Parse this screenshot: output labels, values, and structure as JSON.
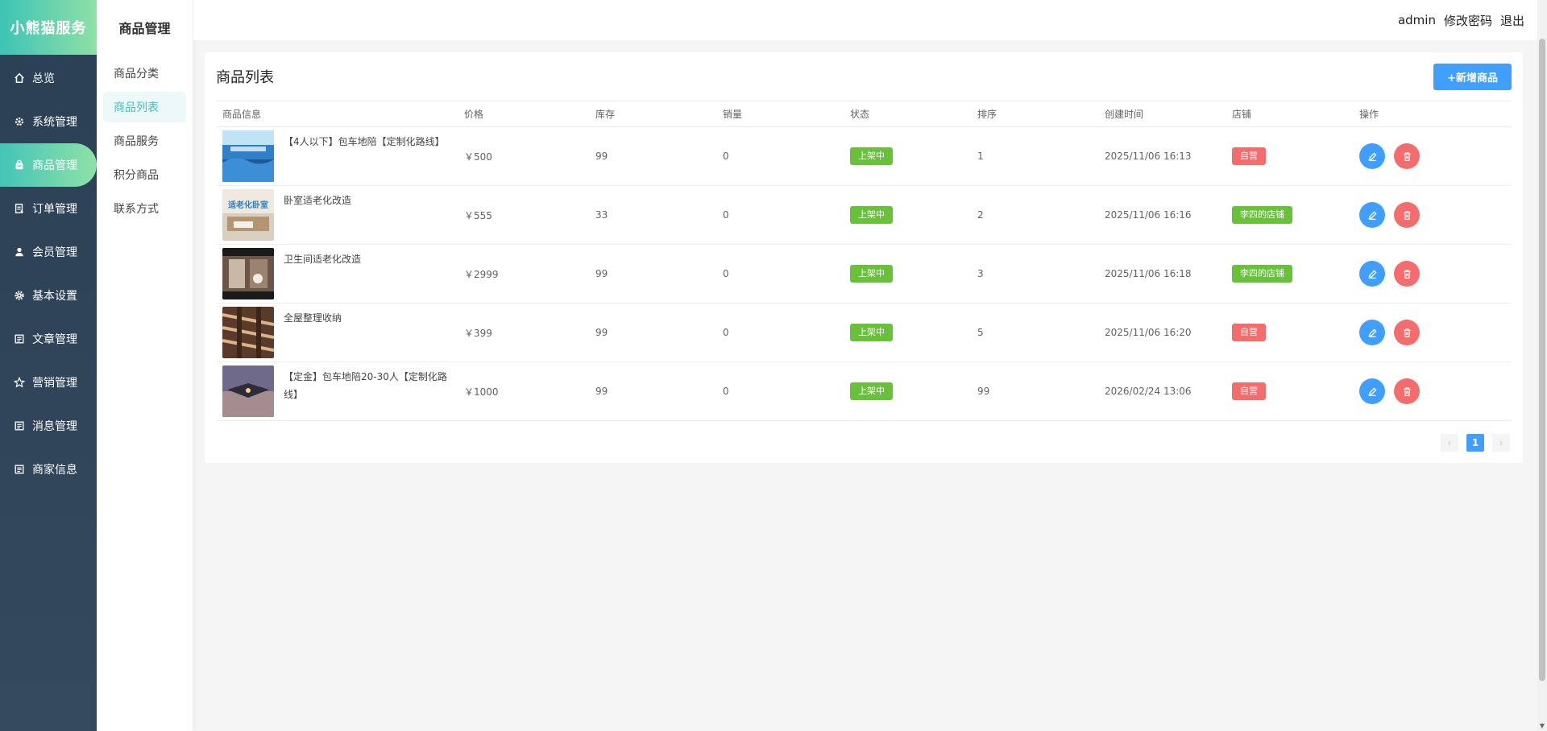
{
  "brand": "小熊猫服务",
  "nav": [
    {
      "label": "总览",
      "icon": "home-icon"
    },
    {
      "label": "系统管理",
      "icon": "settings-icon"
    },
    {
      "label": "商品管理",
      "icon": "bag-icon"
    },
    {
      "label": "订单管理",
      "icon": "order-icon"
    },
    {
      "label": "会员管理",
      "icon": "user-icon"
    },
    {
      "label": "基本设置",
      "icon": "gear-icon"
    },
    {
      "label": "文章管理",
      "icon": "article-icon"
    },
    {
      "label": "营销管理",
      "icon": "star-icon"
    },
    {
      "label": "消息管理",
      "icon": "message-icon"
    },
    {
      "label": "商家信息",
      "icon": "merchant-icon"
    }
  ],
  "subnav": {
    "title": "商品管理",
    "items": [
      "商品分类",
      "商品列表",
      "商品服务",
      "积分商品",
      "联系方式"
    ]
  },
  "header": {
    "user": "admin",
    "change_password": "修改密码",
    "logout": "退出"
  },
  "card": {
    "title": "商品列表",
    "add_button": "+新增商品"
  },
  "table": {
    "columns": [
      "商品信息",
      "价格",
      "库存",
      "销量",
      "状态",
      "排序",
      "创建时间",
      "店铺",
      "操作"
    ],
    "rows": [
      {
        "name": "【4人以下】包车地陪【定制化路线】",
        "price": "￥500",
        "stock": "99",
        "sales": "0",
        "status": "上架中",
        "sort": "1",
        "created": "2025/11/06 16:13",
        "shop": "自营",
        "shop_color": "red"
      },
      {
        "name": "卧室适老化改造",
        "price": "￥555",
        "stock": "33",
        "sales": "0",
        "status": "上架中",
        "sort": "2",
        "created": "2025/11/06 16:16",
        "shop": "李四的店铺",
        "shop_color": "green"
      },
      {
        "name": "卫生间适老化改造",
        "price": "￥2999",
        "stock": "99",
        "sales": "0",
        "status": "上架中",
        "sort": "3",
        "created": "2025/11/06 16:18",
        "shop": "李四的店铺",
        "shop_color": "green"
      },
      {
        "name": "全屋整理收纳",
        "price": "￥399",
        "stock": "99",
        "sales": "0",
        "status": "上架中",
        "sort": "5",
        "created": "2025/11/06 16:20",
        "shop": "自营",
        "shop_color": "red"
      },
      {
        "name": "【定金】包车地陪20-30人【定制化路线】",
        "price": "￥1000",
        "stock": "99",
        "sales": "0",
        "status": "上架中",
        "sort": "99",
        "created": "2026/02/24 13:06",
        "shop": "自营",
        "shop_color": "red"
      }
    ]
  },
  "thumb_text": {
    "row2": "适老化卧室"
  },
  "pager": {
    "prev": "‹",
    "current": "1",
    "next": "›"
  }
}
